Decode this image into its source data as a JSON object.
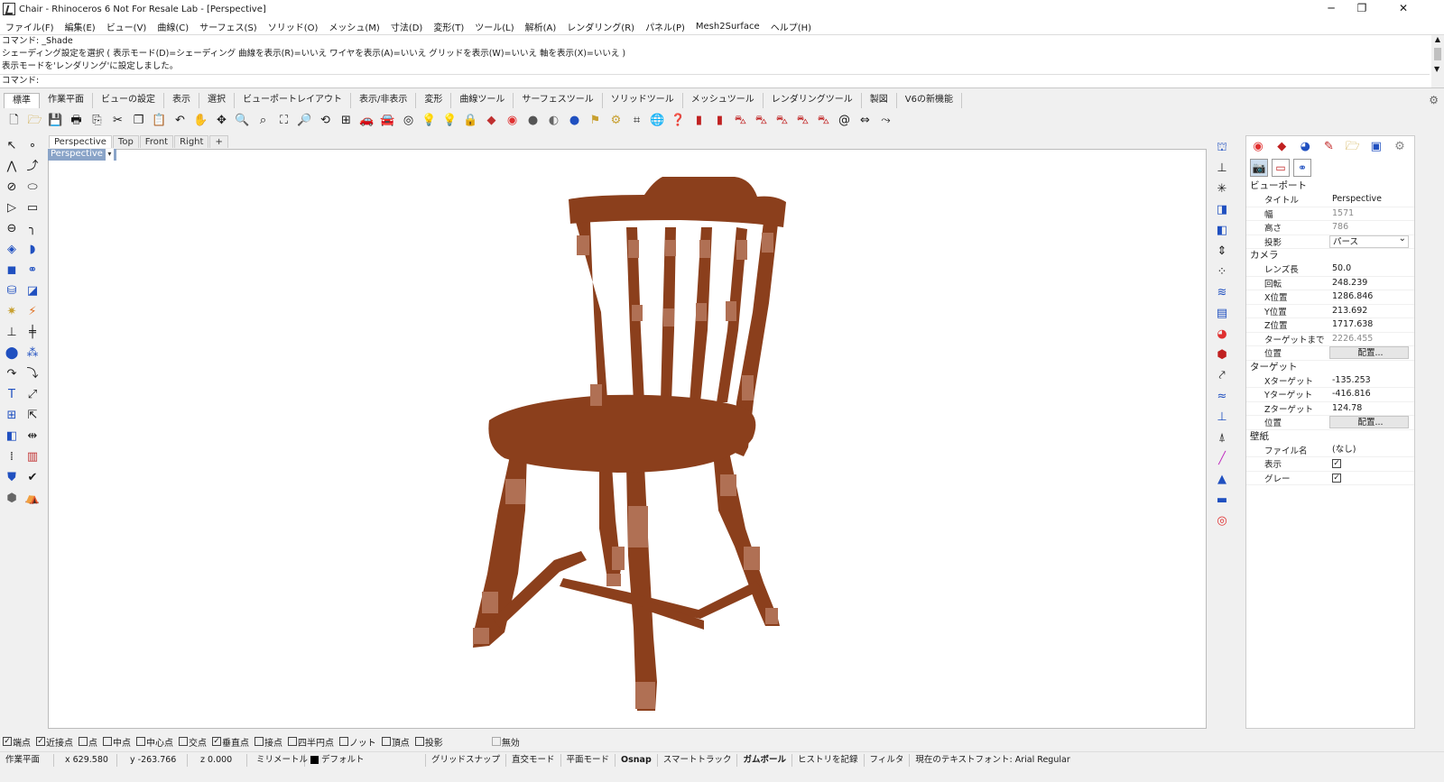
{
  "window": {
    "title": "Chair - Rhinoceros 6 Not For Resale Lab - [Perspective]",
    "minimize": "─",
    "restore": "❐",
    "close": "✕"
  },
  "menu": [
    "ファイル(F)",
    "編集(E)",
    "ビュー(V)",
    "曲線(C)",
    "サーフェス(S)",
    "ソリッド(O)",
    "メッシュ(M)",
    "寸法(D)",
    "変形(T)",
    "ツール(L)",
    "解析(A)",
    "レンダリング(R)",
    "パネル(P)",
    "Mesh2Surface",
    "ヘルプ(H)"
  ],
  "command": {
    "history": [
      "コマンド: _Shade",
      "シェーディング設定を選択 ( 表示モード(D)=シェーディング 曲線を表示(R)=いいえ ワイヤを表示(A)=いいえ グリッドを表示(W)=いいえ 軸を表示(X)=いいえ )",
      "表示モードを'レンダリング'に設定しました。"
    ],
    "prompt": "コマンド:"
  },
  "tabs": [
    "標準",
    "作業平面",
    "ビューの設定",
    "表示",
    "選択",
    "ビューポートレイアウト",
    "表示/非表示",
    "変形",
    "曲線ツール",
    "サーフェスツール",
    "ソリッドツール",
    "メッシュツール",
    "レンダリングツール",
    "製図",
    "V6の新機能"
  ],
  "viewport_tabs": [
    "Perspective",
    "Top",
    "Front",
    "Right",
    "+"
  ],
  "viewport_label": "Perspective",
  "panel": {
    "viewport_header": "ビューポート",
    "viewport_rows": [
      {
        "k": "タイトル",
        "v": "Perspective",
        "style": ""
      },
      {
        "k": "幅",
        "v": "1571",
        "style": "gray"
      },
      {
        "k": "高さ",
        "v": "786",
        "style": "gray"
      },
      {
        "k": "投影",
        "v": "パース",
        "style": "sel"
      }
    ],
    "camera_header": "カメラ",
    "camera_rows": [
      {
        "k": "レンズ長",
        "v": "50.0",
        "style": ""
      },
      {
        "k": "回転",
        "v": "248.239",
        "style": ""
      },
      {
        "k": "X位置",
        "v": "1286.846",
        "style": ""
      },
      {
        "k": "Y位置",
        "v": "213.692",
        "style": ""
      },
      {
        "k": "Z位置",
        "v": "1717.638",
        "style": ""
      },
      {
        "k": "ターゲットまで",
        "v": "2226.455",
        "style": "gray"
      },
      {
        "k": "位置",
        "v": "配置...",
        "style": "btn"
      }
    ],
    "target_header": "ターゲット",
    "target_rows": [
      {
        "k": "Xターゲット",
        "v": "-135.253",
        "style": ""
      },
      {
        "k": "Yターゲット",
        "v": "-416.816",
        "style": ""
      },
      {
        "k": "Zターゲット",
        "v": "124.78",
        "style": ""
      },
      {
        "k": "位置",
        "v": "配置...",
        "style": "btn"
      }
    ],
    "wallpaper_header": "壁紙",
    "wallpaper_rows": [
      {
        "k": "ファイル名",
        "v": "(なし)",
        "style": ""
      },
      {
        "k": "表示",
        "v": "✓",
        "style": "check"
      },
      {
        "k": "グレー",
        "v": "✓",
        "style": "check"
      }
    ]
  },
  "osnap": [
    {
      "label": "端点",
      "checked": true
    },
    {
      "label": "近接点",
      "checked": true
    },
    {
      "label": "点",
      "checked": false
    },
    {
      "label": "中点",
      "checked": false
    },
    {
      "label": "中心点",
      "checked": false
    },
    {
      "label": "交点",
      "checked": false
    },
    {
      "label": "垂直点",
      "checked": true
    },
    {
      "label": "接点",
      "checked": false
    },
    {
      "label": "四半円点",
      "checked": false
    },
    {
      "label": "ノット",
      "checked": false
    },
    {
      "label": "頂点",
      "checked": false
    },
    {
      "label": "投影",
      "checked": false
    }
  ],
  "osnap_disable": "無効",
  "status": {
    "cplane": "作業平面",
    "x": "x 629.580",
    "y": "y -263.766",
    "z": "z 0.000",
    "units": "ミリメートル",
    "layer": "デフォルト",
    "grid_snap": "グリッドスナップ",
    "ortho": "直交モード",
    "planar": "平面モード",
    "osnap": "Osnap",
    "smarttrack": "スマートトラック",
    "gumball": "ガムボール",
    "history": "ヒストリを記録",
    "filter": "フィルタ",
    "font": "現在のテキストフォント: Arial Regular"
  },
  "colors": {
    "chair": "#8b3f1c",
    "chair_highlight": "#b07054",
    "viewport_label": "#8aa4c8"
  }
}
